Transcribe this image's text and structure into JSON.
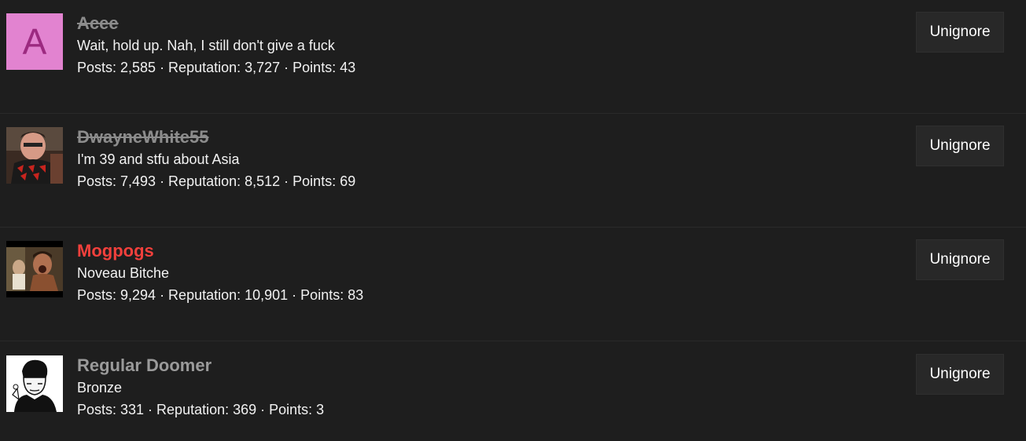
{
  "ignored_users": [
    {
      "username": "Acee",
      "avatar_letter": "A",
      "avatar_type": "letter",
      "avatar_bg": "#e283d0",
      "avatar_fg": "#9c2a80",
      "username_style": "strikethrough",
      "user_title": "Wait, hold up. Nah, I still don't give a fuck",
      "stats": "Posts: 2,585 · Reputation: 3,727 · Points: 43",
      "button_label": "Unignore"
    },
    {
      "username": "DwayneWhite55",
      "avatar_type": "photo",
      "username_style": "strikethrough",
      "user_title": "I'm 39 and stfu about Asia",
      "stats": "Posts: 7,493 · Reputation: 8,512 · Points: 69",
      "button_label": "Unignore"
    },
    {
      "username": "Mogpogs",
      "avatar_type": "photo",
      "username_style": "red",
      "user_title": "Noveau Bitche",
      "stats": "Posts: 9,294 · Reputation: 10,901 · Points: 83",
      "button_label": "Unignore"
    },
    {
      "username": "Regular Doomer",
      "avatar_type": "drawing",
      "username_style": "grey",
      "user_title": "Bronze",
      "stats": "Posts: 331 · Reputation: 369 · Points: 3",
      "button_label": "Unignore"
    }
  ],
  "colors": {
    "background": "#1e1e1e",
    "button_bg": "#282828",
    "username_red": "#f2403c",
    "username_muted": "#8c8c8c"
  }
}
